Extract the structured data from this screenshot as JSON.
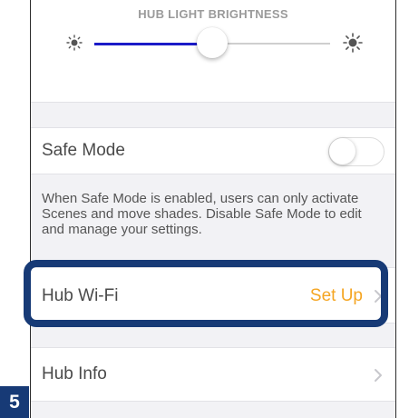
{
  "brightness": {
    "title": "HUB LIGHT BRIGHTNESS",
    "level_percent": 50,
    "low_icon": "sun-small-icon",
    "high_icon": "sun-large-icon"
  },
  "safe_mode": {
    "label": "Safe Mode",
    "enabled": false,
    "description": "When Safe Mode is enabled, users can only activate Scenes and move shades. Disable Safe Mode to edit and manage your settings."
  },
  "hub_wifi": {
    "label": "Hub Wi-Fi",
    "value": "Set Up",
    "highlighted": true
  },
  "hub_info": {
    "label": "Hub Info"
  },
  "step_badge": "5",
  "colors": {
    "accent_blue": "#1b1bc8",
    "value_orange": "#f5a623",
    "highlight_navy": "#173a76",
    "background_gray": "#f2f2f5"
  }
}
